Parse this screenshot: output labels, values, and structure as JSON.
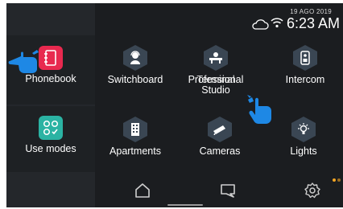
{
  "status": {
    "date": "19 AGO 2019",
    "time": "6:23 AM",
    "cloud_icon": "cloud-icon",
    "wifi_icon": "wifi-icon"
  },
  "tiles": {
    "phonebook": "Phonebook",
    "switchboard": "Switchboard",
    "professional_line1": "Professional",
    "professional_overlap": "Terminal",
    "professional_line2": "Studio",
    "intercom": "Intercom",
    "use_modes": "Use modes",
    "apartments": "Apartments",
    "cameras": "Cameras",
    "lights": "Lights"
  },
  "dock": {
    "home_icon": "home-icon",
    "chat_icon": "chat-icon",
    "settings_icon": "gear-icon"
  },
  "colors": {
    "phonebook_accent": "#e8294f",
    "use_modes_accent": "#2bb3a3",
    "hex_bg": "#3a4653",
    "hand_blue": "#1e88e5",
    "dot_orange": "#f5a623"
  }
}
